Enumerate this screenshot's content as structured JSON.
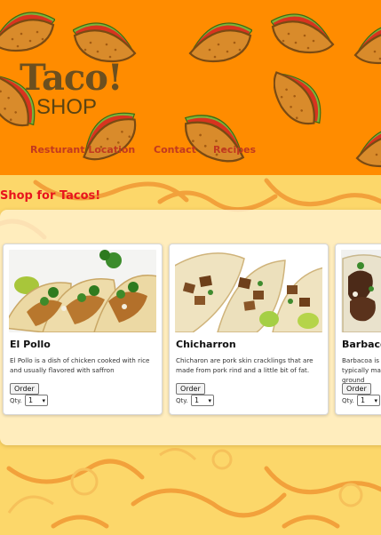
{
  "header": {
    "logo_title": "Taco!",
    "logo_subtitle": "SHOP",
    "colors": {
      "background": "#ff8c00",
      "nav_link": "#c2391f"
    }
  },
  "nav": {
    "items": [
      {
        "label": "Resturant Location"
      },
      {
        "label": "Contact"
      },
      {
        "label": "Recipes"
      }
    ]
  },
  "shop": {
    "title": "Shop for Tacos!",
    "title_color": "#e8141d",
    "products": [
      {
        "name": "El Pollo",
        "description": "El Pollo is a dish of chicken cooked with rice and usually flavored with saffron",
        "order_label": "Order",
        "qty_label": "Qty.",
        "qty_value": "1"
      },
      {
        "name": "Chicharron",
        "description": "Chicharon are pork skin cracklings that are made from pork rind and a little bit of fat.",
        "order_label": "Order",
        "qty_label": "Qty.",
        "qty_value": "1"
      },
      {
        "name": "Barbacoa",
        "description": "Barbacoa is a form of cooking meat that typically makes use of a hole dug in the ground",
        "order_label": "Order",
        "qty_label": "Qty.",
        "qty_value": "1"
      }
    ]
  }
}
